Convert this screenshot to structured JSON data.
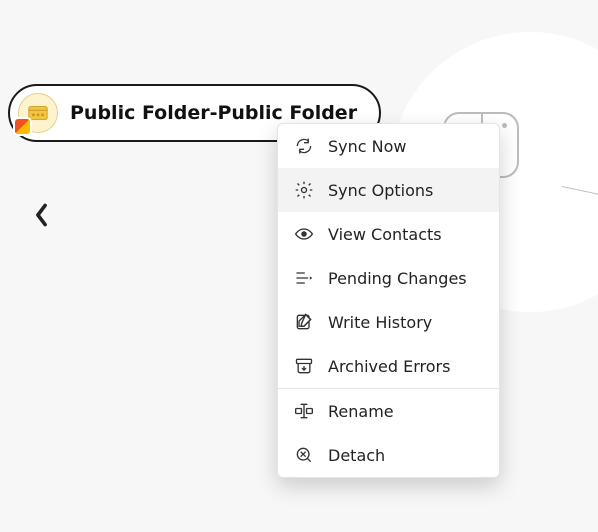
{
  "chip": {
    "label": "Public Folder-Public Folder",
    "icon": "public-folder-icon",
    "provider_badge": "office-365-icon"
  },
  "back": {
    "icon": "chevron-left-icon"
  },
  "device_tile": {
    "icon": "device-icon"
  },
  "menu": {
    "hovered_index": 1,
    "items": [
      {
        "id": "sync-now",
        "label": "Sync Now",
        "icon": "refresh-icon"
      },
      {
        "id": "sync-options",
        "label": "Sync Options",
        "icon": "gear-icon"
      },
      {
        "id": "view-contacts",
        "label": "View Contacts",
        "icon": "eye-icon"
      },
      {
        "id": "pending-changes",
        "label": "Pending Changes",
        "icon": "pending-icon"
      },
      {
        "id": "write-history",
        "label": "Write History",
        "icon": "edit-icon"
      },
      {
        "id": "archived-errors",
        "label": "Archived Errors",
        "icon": "archive-icon"
      },
      {
        "id": "rename",
        "label": "Rename",
        "icon": "rename-icon",
        "separator_before": true
      },
      {
        "id": "detach",
        "label": "Detach",
        "icon": "detach-icon"
      }
    ]
  }
}
